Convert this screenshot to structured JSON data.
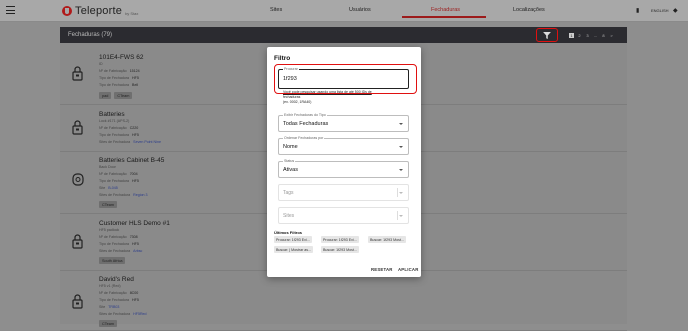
{
  "app": {
    "logo_text": "Teleporte",
    "logo_sub": "by Stax"
  },
  "nav": {
    "items": [
      {
        "label": "Sites",
        "active": false
      },
      {
        "label": "Usuários",
        "active": false
      },
      {
        "label": "Fechaduras",
        "active": true
      },
      {
        "label": "Localizações",
        "active": false
      }
    ],
    "lang": "ENGLISH"
  },
  "listbar": {
    "title": "Fechaduras (79)",
    "pages": [
      "1",
      "2",
      "3",
      "...",
      "8",
      ">"
    ]
  },
  "rows": [
    {
      "title": "101E4-FWS 62",
      "lines": [
        {
          "label": "ID",
          "value": ""
        },
        {
          "label": "Nº de Fabricação",
          "value": "15124"
        },
        {
          "label": "Tipo de Fechadura",
          "value": "HF5"
        },
        {
          "label": "Tipo de Fechadura",
          "value": "Bell"
        }
      ],
      "chips": [
        "pad",
        "CTeam"
      ]
    },
    {
      "title": "Batteries",
      "lines": [
        {
          "label": "Lock #171 (APS-2)",
          "value": ""
        },
        {
          "label": "Nº de Fabricação",
          "value": "C220"
        },
        {
          "label": "Tipo de Fechadura",
          "value": "HF5"
        },
        {
          "label": "Sites de Fechadura",
          "value": "Seven Point Nine",
          "link": true
        }
      ],
      "chips": []
    },
    {
      "title": "Batteries Cabinet B-45",
      "lines": [
        {
          "label": "Back Door",
          "value": ""
        },
        {
          "label": "Nº de Fabricação",
          "value": "7004"
        },
        {
          "label": "Tipo de Fechadura",
          "value": "HF5"
        },
        {
          "label": "Site",
          "value": "B-045",
          "link": true
        },
        {
          "label": "Sites de Fechadura",
          "value": "Region 3",
          "link": true
        }
      ],
      "chips": [
        "CTeam"
      ]
    },
    {
      "title": "Customer HLS Demo #1",
      "lines": [
        {
          "label": "HF5 padlock",
          "value": ""
        },
        {
          "label": "Nº de Fabricação",
          "value": "7308"
        },
        {
          "label": "Tipo de Fechadura",
          "value": "HF5"
        },
        {
          "label": "Sites de Fechadura",
          "value": "Arbsc",
          "link": true
        }
      ],
      "chips": [
        "South Africa"
      ]
    },
    {
      "title": "David's Red",
      "lines": [
        {
          "label": "HF5 v1 (Red)",
          "value": ""
        },
        {
          "label": "Nº de Fabricação",
          "value": "8C00"
        },
        {
          "label": "Tipo de Fechadura",
          "value": "HF5"
        },
        {
          "label": "Site",
          "value": "TRB03",
          "link": true
        },
        {
          "label": "Sites de Fechadura",
          "value": "HF5Red",
          "link": true
        }
      ],
      "chips": [
        "CTeam"
      ]
    }
  ],
  "modal": {
    "title": "Filtro",
    "search": {
      "label": "Procurar",
      "value": "1f293",
      "helper": "Você pode pesquisar usando uma lista de até 500 IDs de",
      "helper2": "fechaduras",
      "helper3": "(ex. 0002, 1RA40)"
    },
    "type_select": {
      "label": "Exibir Fechaduras do Tipo",
      "value": "Todas Fechaduras"
    },
    "order_select": {
      "label": "Ordenar Fechaduras por",
      "value": "Nome"
    },
    "status_select": {
      "label": "Status",
      "value": "Ativas"
    },
    "tags": {
      "placeholder": "Tags"
    },
    "sites": {
      "placeholder": "Sites"
    },
    "recent": {
      "title": "Últimos Filtros",
      "chips": [
        "Procurar: 1f293 Exi...",
        "Procurar: 1f293 Exi...",
        "Buscar: 1f293 Most...",
        "Buscar: | Mostrar as...",
        "Buscar: 1f293 Most..."
      ]
    },
    "actions": {
      "reset": "RESETAR",
      "apply": "APLICAR"
    }
  },
  "colors": {
    "accent": "#9c1b1b",
    "highlight": "#e01010",
    "header_dark": "#2b2b30"
  }
}
